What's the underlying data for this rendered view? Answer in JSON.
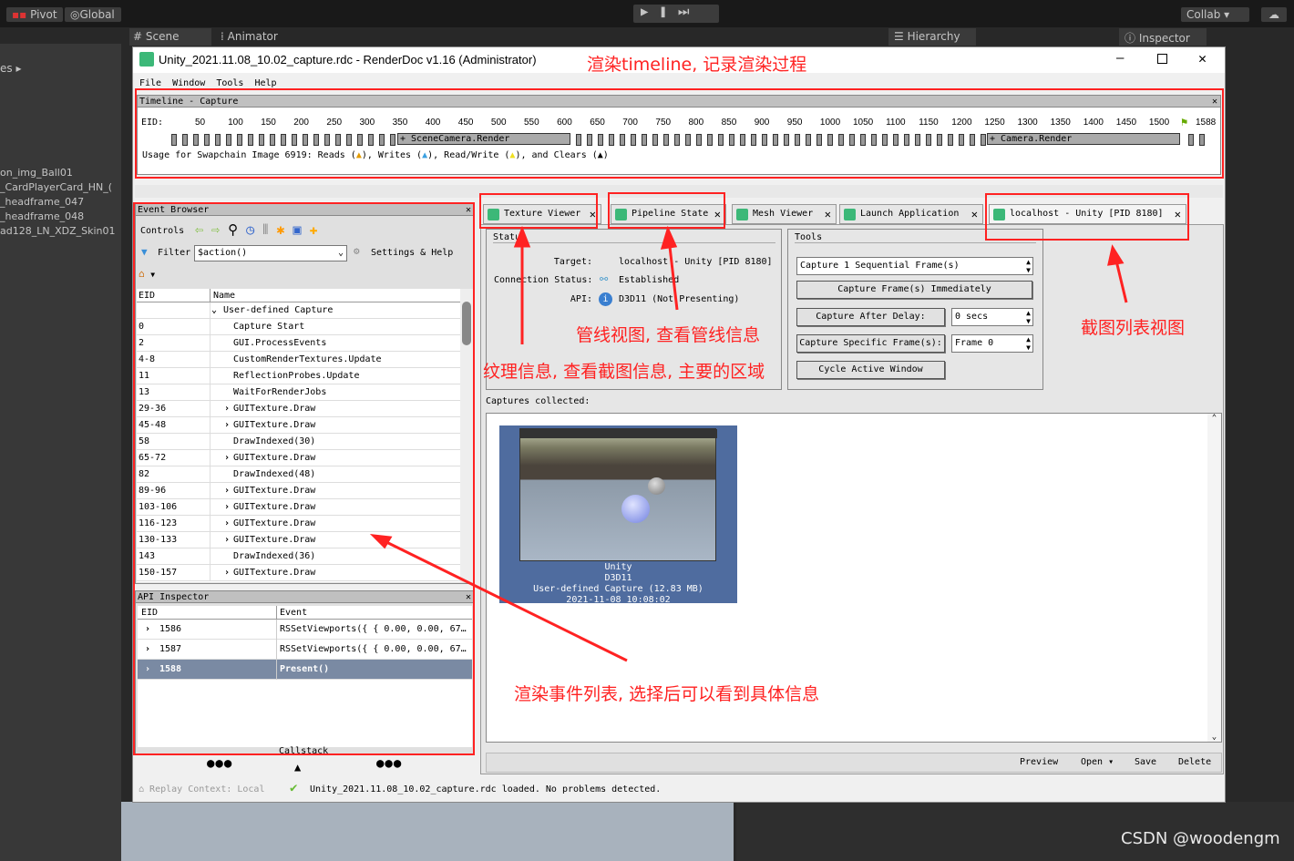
{
  "unity": {
    "pivot": "Pivot",
    "global": "Global",
    "scene_tab": "Scene",
    "animator_tab": "Animator",
    "hierarchy_tab": "Hierarchy",
    "inspector_tab": "Inspector",
    "collab": "Collab ▾",
    "left_label": "es ▸",
    "hierarchy_items": [
      "on_img_Ball01",
      "_CardPlayerCard_HN_(",
      "_headframe_047",
      "_headframe_048",
      "ad128_LN_XDZ_Skin01"
    ]
  },
  "window": {
    "title": "Unity_2021.11.08_10.02_capture.rdc - RenderDoc v1.16 (Administrator)",
    "menu": [
      "File",
      "Window",
      "Tools",
      "Help"
    ]
  },
  "timeline": {
    "title": "Timeline - Capture",
    "eid_label": "EID:",
    "ticks": [
      "50",
      "100",
      "150",
      "200",
      "250",
      "300",
      "350",
      "400",
      "450",
      "500",
      "550",
      "600",
      "650",
      "700",
      "750",
      "800",
      "850",
      "900",
      "950",
      "1000",
      "1050",
      "1100",
      "1150",
      "1200",
      "1250",
      "1300",
      "1350",
      "1400",
      "1450",
      "1500"
    ],
    "end_marker": "1588",
    "markers": [
      "+ SceneCamera.Render",
      "+ Camera.Render"
    ],
    "usage": {
      "prefix": "Usage for Swapchain Image 6919: Reads (",
      "reads_color": "#e39b00",
      "writes": "), Writes (",
      "writes_color": "#3aa0e0",
      "readwrite": "), Read/Write (",
      "readwrite_color": "#f0e020",
      "clears": "), and Clears (",
      "clears_color": "#000000",
      "suffix": ")"
    }
  },
  "event_browser": {
    "title": "Event Browser",
    "controls": "Controls",
    "filter_label": "Filter",
    "filter_value": "$action()",
    "settings": "Settings & Help",
    "columns": [
      "EID",
      "Name"
    ],
    "rows": [
      {
        "eid": "",
        "name": "User-defined Capture",
        "expander": "open"
      },
      {
        "eid": "0",
        "name": "Capture Start"
      },
      {
        "eid": "2",
        "name": "GUI.ProcessEvents"
      },
      {
        "eid": "4-8",
        "name": "CustomRenderTextures.Update"
      },
      {
        "eid": "11",
        "name": "ReflectionProbes.Update"
      },
      {
        "eid": "13",
        "name": "WaitForRenderJobs"
      },
      {
        "eid": "29-36",
        "name": "GUITexture.Draw",
        "expander": "closed"
      },
      {
        "eid": "45-48",
        "name": "GUITexture.Draw",
        "expander": "closed"
      },
      {
        "eid": "58",
        "name": "DrawIndexed(30)"
      },
      {
        "eid": "65-72",
        "name": "GUITexture.Draw",
        "expander": "closed"
      },
      {
        "eid": "82",
        "name": "DrawIndexed(48)"
      },
      {
        "eid": "89-96",
        "name": "GUITexture.Draw",
        "expander": "closed"
      },
      {
        "eid": "103-106",
        "name": "GUITexture.Draw",
        "expander": "closed"
      },
      {
        "eid": "116-123",
        "name": "GUITexture.Draw",
        "expander": "closed"
      },
      {
        "eid": "130-133",
        "name": "GUITexture.Draw",
        "expander": "closed"
      },
      {
        "eid": "143",
        "name": "DrawIndexed(36)"
      },
      {
        "eid": "150-157",
        "name": "GUITexture.Draw",
        "expander": "closed"
      }
    ]
  },
  "api_inspector": {
    "title": "API Inspector",
    "columns": [
      "EID",
      "Event"
    ],
    "rows": [
      {
        "eid": "1586",
        "event": "RSSetViewports({ { 0.00, 0.00, 67…"
      },
      {
        "eid": "1587",
        "event": "RSSetViewports({ { 0.00, 0.00, 67…"
      },
      {
        "eid": "1588",
        "event": "Present()",
        "selected": true
      }
    ],
    "callstack": "Callstack"
  },
  "tabs": [
    "Texture Viewer",
    "Pipeline State",
    "Mesh Viewer",
    "Launch Application",
    "localhost - Unity [PID 8180]"
  ],
  "status": {
    "title": "Status",
    "target_label": "Target:",
    "target": "localhost - Unity [PID 8180]",
    "conn_label": "Connection Status:",
    "conn": "Established",
    "api_label": "API:",
    "api": "D3D11 (Not Presenting)"
  },
  "tools": {
    "title": "Tools",
    "seq": "Capture 1 Sequential Frame(s)",
    "immediate": "Capture Frame(s) Immediately",
    "delay_btn": "Capture After Delay:",
    "delay_val": "0 secs",
    "specific_btn": "Capture Specific Frame(s):",
    "specific_val": "Frame 0",
    "cycle": "Cycle Active Window"
  },
  "captures": {
    "label": "Captures collected:",
    "item": {
      "line1": "Unity",
      "line2": "D3D11",
      "line3": "User-defined Capture (12.83 MB)",
      "line4": "2021-11-08 10:08:02"
    },
    "actions": [
      "Preview",
      "Open ▾",
      "Save",
      "Delete"
    ]
  },
  "statusbar": {
    "replay": "Replay Context: Local",
    "message": "Unity_2021.11.08_10.02_capture.rdc loaded. No problems detected."
  },
  "annotations": {
    "timeline": "渲染timeline, 记录渲染过程",
    "pipeline": "管线视图, 查看管线信息",
    "texture": "纹理信息, 查看截图信息, 主要的区域",
    "captures": "截图列表视图",
    "events": "渲染事件列表, 选择后可以看到具体信息",
    "color": "#ff2222"
  },
  "watermark": "CSDN @woodengm"
}
